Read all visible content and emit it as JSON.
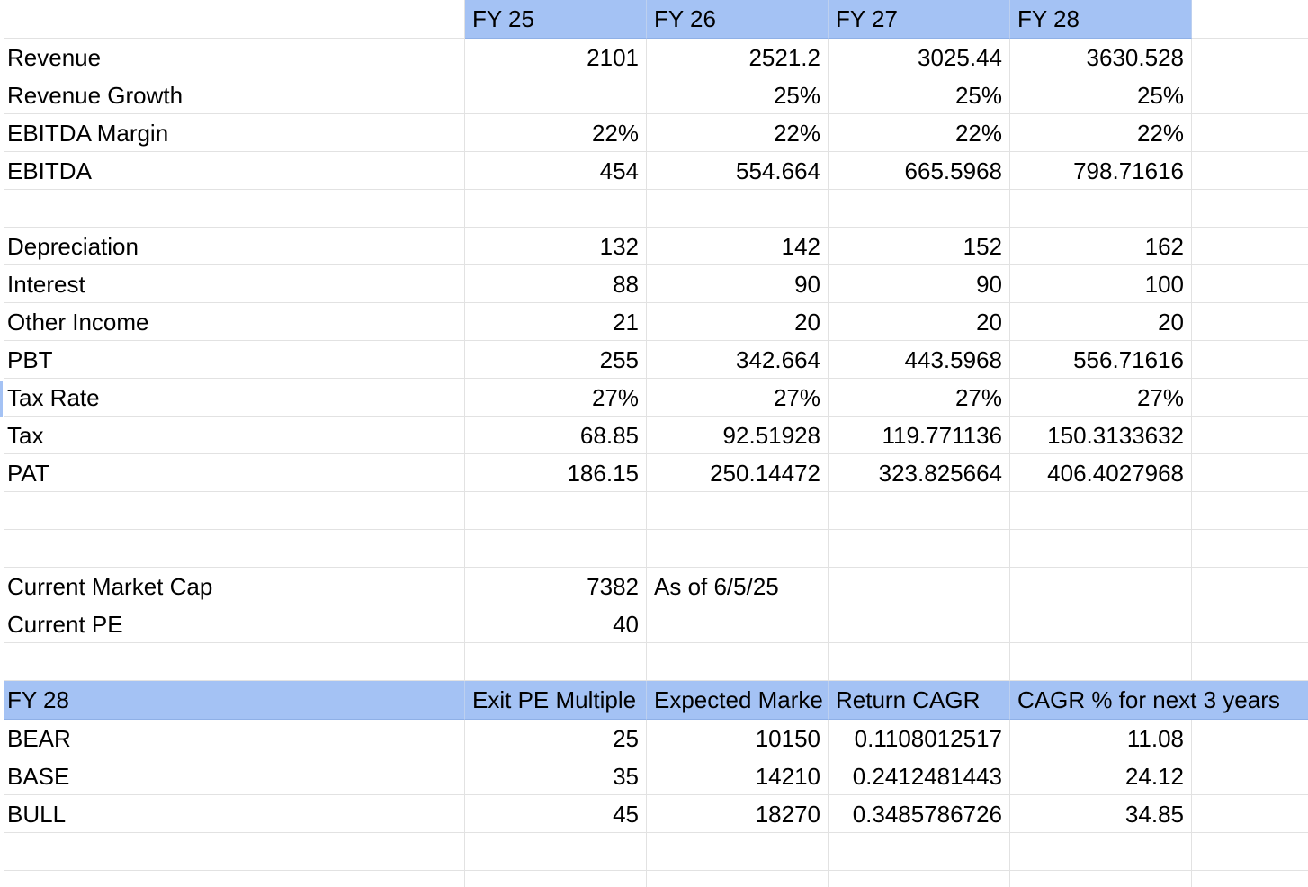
{
  "header": {
    "label": "",
    "years": [
      "FY 25",
      "FY 26",
      "FY 27",
      "FY 28"
    ]
  },
  "pl": [
    {
      "label": "Revenue",
      "values": [
        "2101",
        "2521.2",
        "3025.44",
        "3630.528"
      ]
    },
    {
      "label": "Revenue Growth",
      "values": [
        "",
        "25%",
        "25%",
        "25%"
      ]
    },
    {
      "label": "EBITDA Margin",
      "values": [
        "22%",
        "22%",
        "22%",
        "22%"
      ]
    },
    {
      "label": "EBITDA",
      "values": [
        "454",
        "554.664",
        "665.5968",
        "798.71616"
      ]
    },
    {
      "label": "",
      "values": [
        "",
        "",
        "",
        ""
      ]
    },
    {
      "label": "Depreciation",
      "values": [
        "132",
        "142",
        "152",
        "162"
      ]
    },
    {
      "label": "Interest",
      "values": [
        "88",
        "90",
        "90",
        "100"
      ]
    },
    {
      "label": "Other Income",
      "values": [
        "21",
        "20",
        "20",
        "20"
      ]
    },
    {
      "label": "PBT",
      "values": [
        "255",
        "342.664",
        "443.5968",
        "556.71616"
      ]
    },
    {
      "label": "Tax Rate",
      "values": [
        "27%",
        "27%",
        "27%",
        "27%"
      ]
    },
    {
      "label": "Tax",
      "values": [
        "68.85",
        "92.51928",
        "119.771136",
        "150.3133632"
      ]
    },
    {
      "label": "PAT",
      "values": [
        "186.15",
        "250.14472",
        "323.825664",
        "406.4027968"
      ]
    }
  ],
  "market": {
    "market_cap_label": "Current Market Cap",
    "market_cap_value": "7382",
    "as_of_note": "As of 6/5/25",
    "pe_label": "Current PE",
    "pe_value": "40"
  },
  "scenarios": {
    "headers": [
      "FY 28",
      "Exit PE Multiple",
      "Expected Marke",
      "Return CAGR",
      "CAGR % for next 3 years"
    ],
    "rows": [
      {
        "name": "BEAR",
        "exit_pe": "25",
        "expected_market": "10150",
        "return_cagr": "0.1108012517",
        "cagr_pct": "11.08"
      },
      {
        "name": "BASE",
        "exit_pe": "35",
        "expected_market": "14210",
        "return_cagr": "0.2412481443",
        "cagr_pct": "24.12"
      },
      {
        "name": "BULL",
        "exit_pe": "45",
        "expected_market": "18270",
        "return_cagr": "0.3485786726",
        "cagr_pct": "34.85"
      }
    ]
  },
  "colors": {
    "header_fill": "#a4c2f4",
    "gridline": "#e2e2e2"
  }
}
